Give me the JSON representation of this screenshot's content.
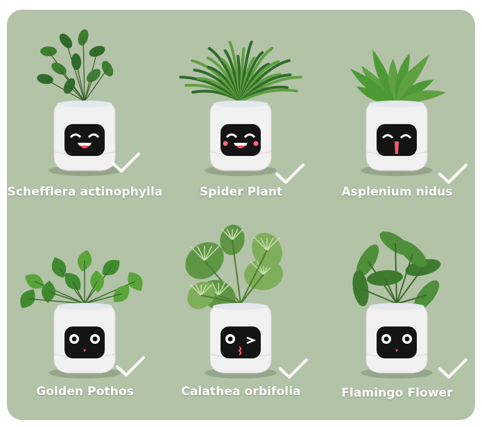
{
  "plants": [
    {
      "name": "Schefflera actinophylla",
      "face": "grin",
      "leaf": "schefflera"
    },
    {
      "name": "Spider Plant",
      "face": "grin-blush",
      "leaf": "spider"
    },
    {
      "name": "Asplenium nidus",
      "face": "wink-tongue",
      "leaf": "nest"
    },
    {
      "name": "Golden Pothos",
      "face": "round-eyes",
      "leaf": "pothos"
    },
    {
      "name": "Calathea orbifolia",
      "face": "wink-kiss",
      "leaf": "calathea"
    },
    {
      "name": "Flamingo Flower",
      "face": "round-eyes",
      "leaf": "flamingo"
    }
  ],
  "colors": {
    "background": "#b3c3a8",
    "label": "#ffffff",
    "check": "#ffffff",
    "pot": "#f1f1f1",
    "screen": "#141414",
    "leaf_dark": "#2f6b2a",
    "leaf_light": "#5fa040"
  },
  "icons": {
    "selected": "checkmark-icon"
  }
}
